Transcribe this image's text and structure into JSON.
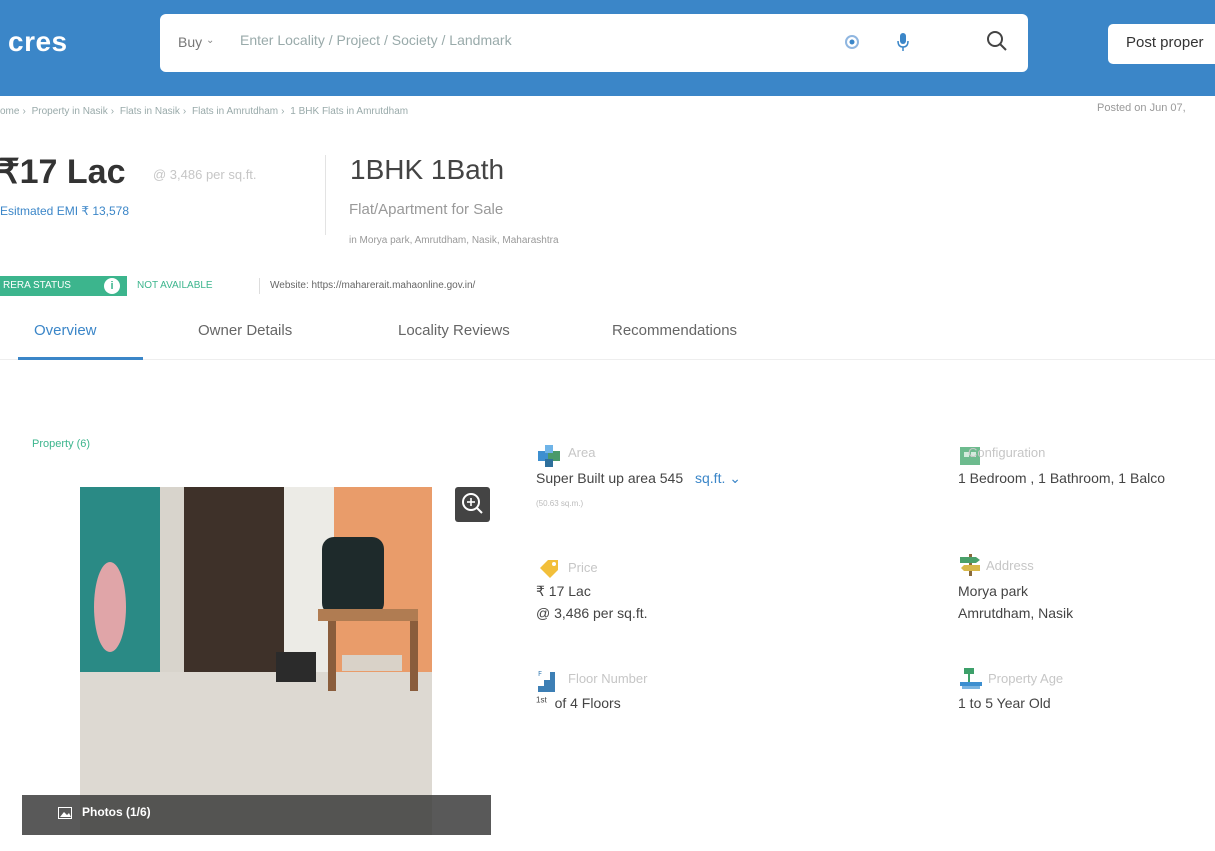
{
  "header": {
    "logo": "cres",
    "buy_label": "Buy",
    "search_placeholder": "Enter Locality / Project / Society / Landmark",
    "post_button": "Post proper"
  },
  "breadcrumb": [
    "ome",
    "Property in Nasik",
    "Flats in Nasik",
    "Flats in Amrutdham",
    "1 BHK Flats in Amrutdham"
  ],
  "posted": "Posted on Jun 07,",
  "listing": {
    "price": "₹17 Lac",
    "price_per": "@ 3,486 per sq.ft.",
    "emi": "Esitmated EMI ₹ 13,578",
    "title": "1BHK 1Bath",
    "subtitle": "Flat/Apartment for Sale",
    "address": "in Morya park, Amrutdham, Nasik, Maharashtra"
  },
  "rera": {
    "label": "RERA STATUS",
    "info": "i",
    "status": "NOT AVAILABLE",
    "website": "Website: https://maharerait.mahaonline.gov.in/"
  },
  "tabs": [
    "Overview",
    "Owner Details",
    "Locality Reviews",
    "Recommendations"
  ],
  "gallery": {
    "label": "Property (6)",
    "photos": "Photos (1/6)"
  },
  "details": {
    "area": {
      "label": "Area",
      "value": "Super Built up area 545",
      "unit": "sq.ft.",
      "sub": "(50.63 sq.m.)"
    },
    "configuration": {
      "label": "Configuration",
      "value": "1 Bedroom , 1 Bathroom, 1 Balco"
    },
    "price": {
      "label": "Price",
      "value": "₹ 17 Lac",
      "sub": "@ 3,486 per sq.ft."
    },
    "address": {
      "label": "Address",
      "line1": "Morya park",
      "line2": "Amrutdham, Nasik"
    },
    "floor": {
      "label": "Floor Number",
      "sup": "1st",
      "value": "of 4 Floors"
    },
    "age": {
      "label": "Property Age",
      "value": "1 to 5 Year Old"
    }
  },
  "colors": {
    "brand": "#3b86c8",
    "rera_green": "#3cb58d"
  }
}
